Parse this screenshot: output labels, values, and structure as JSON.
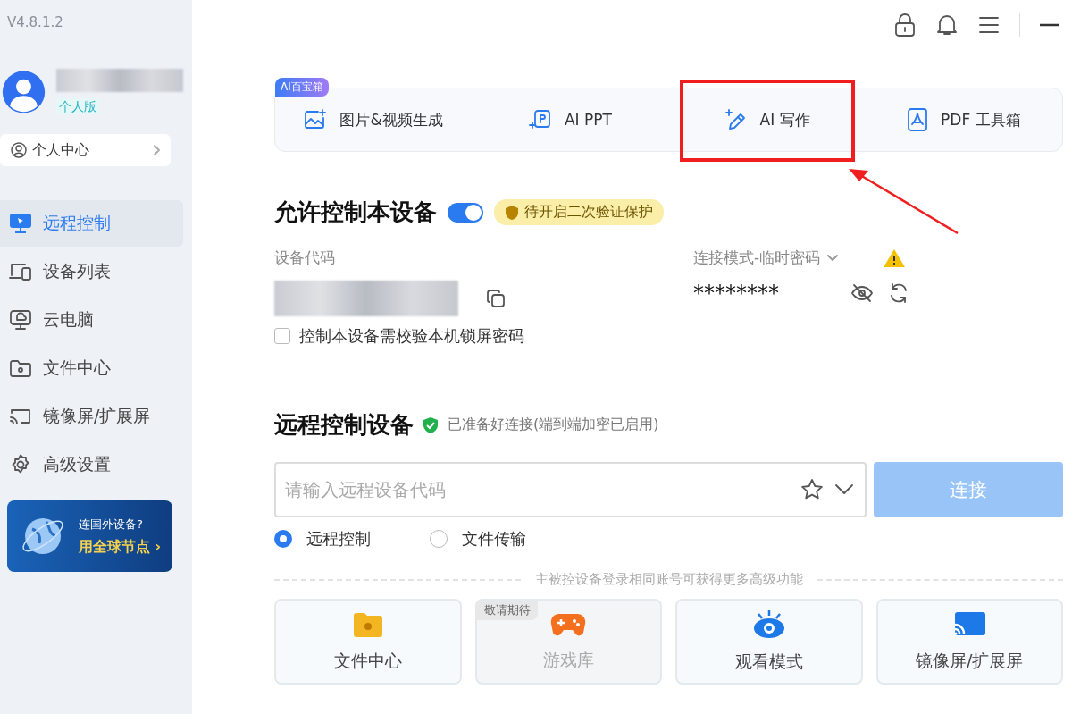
{
  "sidebar": {
    "version": "V4.8.1.2",
    "user": {
      "edition": "个人版"
    },
    "profile_link": "个人中心",
    "items": [
      {
        "label": "远程控制",
        "selected": true
      },
      {
        "label": "设备列表",
        "selected": false
      },
      {
        "label": "云电脑",
        "selected": false
      },
      {
        "label": "文件中心",
        "selected": false
      },
      {
        "label": "镜像屏/扩展屏",
        "selected": false
      },
      {
        "label": "高级设置",
        "selected": false
      }
    ],
    "promo": {
      "line1": "连国外设备?",
      "line2": "用全球节点 ›"
    }
  },
  "ai_toolbox": {
    "badge": "AI百宝箱",
    "tools": [
      {
        "label": "图片&视频生成",
        "highlighted": false
      },
      {
        "label": "AI PPT",
        "highlighted": false
      },
      {
        "label": "AI 写作",
        "highlighted": true
      },
      {
        "label": "PDF 工具箱",
        "highlighted": false
      }
    ]
  },
  "allow_control": {
    "title": "允许控制本设备",
    "on": true,
    "badge": "待开启二次验证保护",
    "device_code_label": "设备代码",
    "mode_label": "连接模式-临时密码",
    "password": "********",
    "lock_check": {
      "label": "控制本设备需校验本机锁屏密码",
      "checked": false
    }
  },
  "remote": {
    "title": "远程控制设备",
    "status": "已准备好连接(端到端加密已启用)",
    "input": {
      "placeholder": "请输入远程设备代码"
    },
    "connect": "连接",
    "modes": [
      {
        "label": "远程控制",
        "selected": true
      },
      {
        "label": "文件传输",
        "selected": false
      }
    ],
    "hint": "主被控设备登录相同账号可获得更多高级功能",
    "features": [
      {
        "label": "文件中心",
        "disabled": false
      },
      {
        "label": "游戏库",
        "disabled": true,
        "tag": "敬请期待"
      },
      {
        "label": "观看模式",
        "disabled": false
      },
      {
        "label": "镜像屏/扩展屏",
        "disabled": false
      }
    ]
  }
}
